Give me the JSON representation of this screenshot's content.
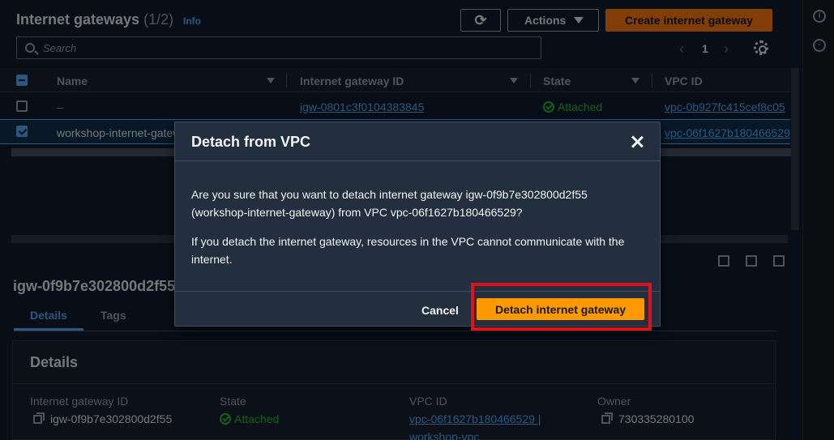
{
  "header": {
    "title": "Internet gateways",
    "count": "(1/2)",
    "info": "Info",
    "refresh_icon": "⟳",
    "actions_label": "Actions",
    "create_label": "Create internet gateway"
  },
  "search": {
    "placeholder": "Search"
  },
  "pagination": {
    "page": "1",
    "prev": "‹",
    "next": "›"
  },
  "table": {
    "columns": [
      "Name",
      "Internet gateway ID",
      "State",
      "VPC ID"
    ],
    "rows": [
      {
        "name": "–",
        "igw_id": "igw-0801c3f0104383845",
        "state": "Attached",
        "vpc_id": "vpc-0b927fc415cef8c05",
        "selected": false
      },
      {
        "name": "workshop-internet-gateway",
        "igw_id": "igw-0f9b7e302800d2f55",
        "state": "Attached",
        "vpc_id": "vpc-06f1627b180466529",
        "selected": true
      }
    ]
  },
  "detail": {
    "title": "igw-0f9b7e302800d2f55",
    "tabs": [
      "Details",
      "Tags"
    ],
    "section_heading": "Details",
    "fields": [
      {
        "label": "Internet gateway ID",
        "value": "igw-0f9b7e302800d2f55"
      },
      {
        "label": "State",
        "value": "Attached"
      },
      {
        "label": "VPC ID",
        "value": "vpc-06f1627b180466529 |",
        "value2": "workshop-vpc"
      },
      {
        "label": "Owner",
        "value": "730335280100"
      }
    ]
  },
  "modal": {
    "title": "Detach from VPC",
    "paragraph1": "Are you sure that you want to detach internet gateway igw-0f9b7e302800d2f55 (workshop-internet-gateway) from VPC vpc-06f1627b180466529?",
    "paragraph2": "If you detach the internet gateway, resources in the VPC cannot communicate with the internet.",
    "cancel_label": "Cancel",
    "confirm_label": "Detach internet gateway"
  },
  "colors": {
    "primary_orange": "#ff9900",
    "link_blue": "#539fe5",
    "success_green": "#29ad32",
    "highlight_red": "#e0101c"
  }
}
